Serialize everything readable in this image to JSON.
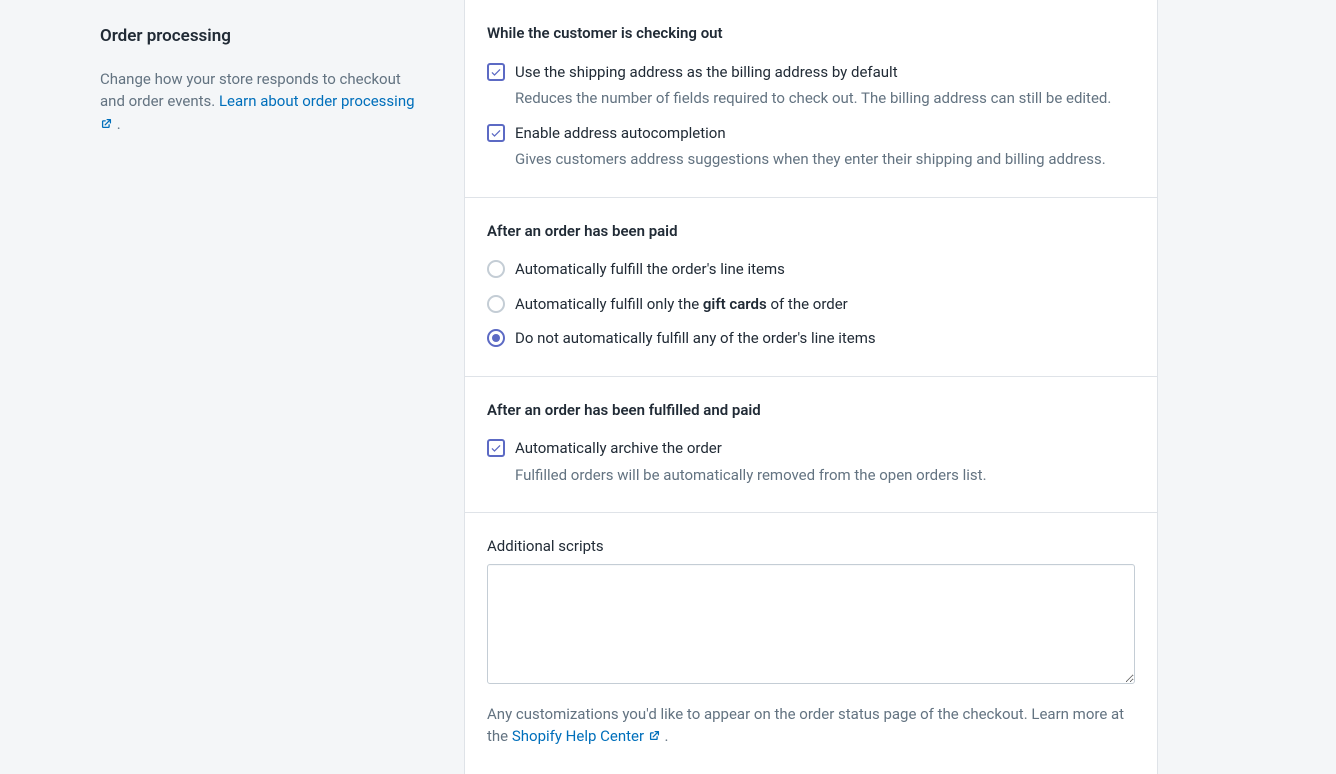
{
  "sidebar": {
    "title": "Order processing",
    "description_part1": "Change how your store responds to checkout and order events. ",
    "link_text": "Learn about order processing",
    "description_part2": " ."
  },
  "section_checkout": {
    "heading": "While the customer is checking out",
    "options": [
      {
        "label": "Use the shipping address as the billing address by default",
        "help": "Reduces the number of fields required to check out. The billing address can still be edited.",
        "checked": true
      },
      {
        "label": "Enable address autocompletion",
        "help": "Gives customers address suggestions when they enter their shipping and billing address.",
        "checked": true
      }
    ]
  },
  "section_paid": {
    "heading": "After an order has been paid",
    "options": [
      {
        "label": "Automatically fulfill the order's line items",
        "selected": false
      },
      {
        "label_pre": "Automatically fulfill only the ",
        "label_bold": "gift cards",
        "label_post": " of the order",
        "selected": false
      },
      {
        "label": "Do not automatically fulfill any of the order's line items",
        "selected": true
      }
    ]
  },
  "section_fulfilled": {
    "heading": "After an order has been fulfilled and paid",
    "option": {
      "label": "Automatically archive the order",
      "help": "Fulfilled orders will be automatically removed from the open orders list.",
      "checked": true
    }
  },
  "section_scripts": {
    "label": "Additional scripts",
    "value": "",
    "help_pre": "Any customizations you'd like to appear on the order status page of the checkout. Learn more at the ",
    "help_link": "Shopify Help Center",
    "help_post": " ."
  }
}
